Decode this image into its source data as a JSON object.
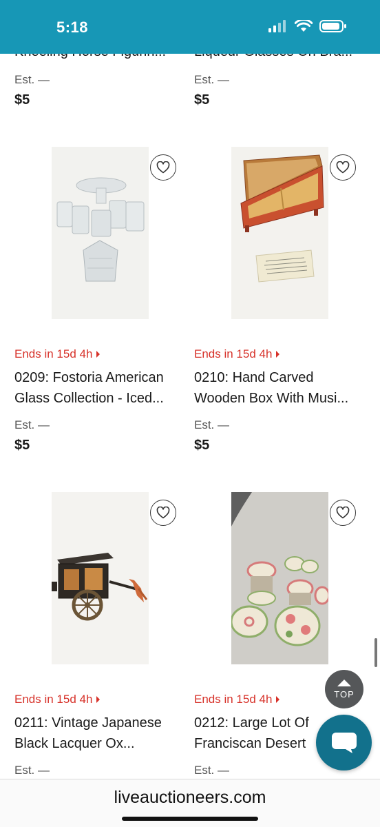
{
  "status_bar": {
    "time": "5:18"
  },
  "cutoff_row": [
    {
      "title": "Kneeling Horse Figurin...",
      "est": "Est. —",
      "price": "$5"
    },
    {
      "title": "Liqueur Glasses On Bra...",
      "est": "Est. —",
      "price": "$5"
    }
  ],
  "lots": [
    {
      "ends": "Ends in 15d 4h",
      "title_line1": "0209: Fostoria American",
      "title_line2": "Glass Collection - Iced...",
      "est": "Est. —",
      "price": "$5"
    },
    {
      "ends": "Ends in 15d 4h",
      "title_line1": "0210: Hand Carved",
      "title_line2": "Wooden Box With Musi...",
      "est": "Est. —",
      "price": "$5"
    },
    {
      "ends": "Ends in 15d 4h",
      "title_line1": "0211: Vintage Japanese",
      "title_line2": "Black Lacquer Ox...",
      "est": "Est. —",
      "price": ""
    },
    {
      "ends": "Ends in 15d 4h",
      "title_line1": "0212: Large Lot Of",
      "title_line2": "Franciscan Desert",
      "est": "Est. —",
      "price": ""
    }
  ],
  "top_button": {
    "label": "TOP"
  },
  "browser": {
    "url": "liveauctioneers.com"
  },
  "colors": {
    "status_bar": "#1797b6",
    "ends_red": "#d7322a",
    "chat": "#12718c"
  }
}
